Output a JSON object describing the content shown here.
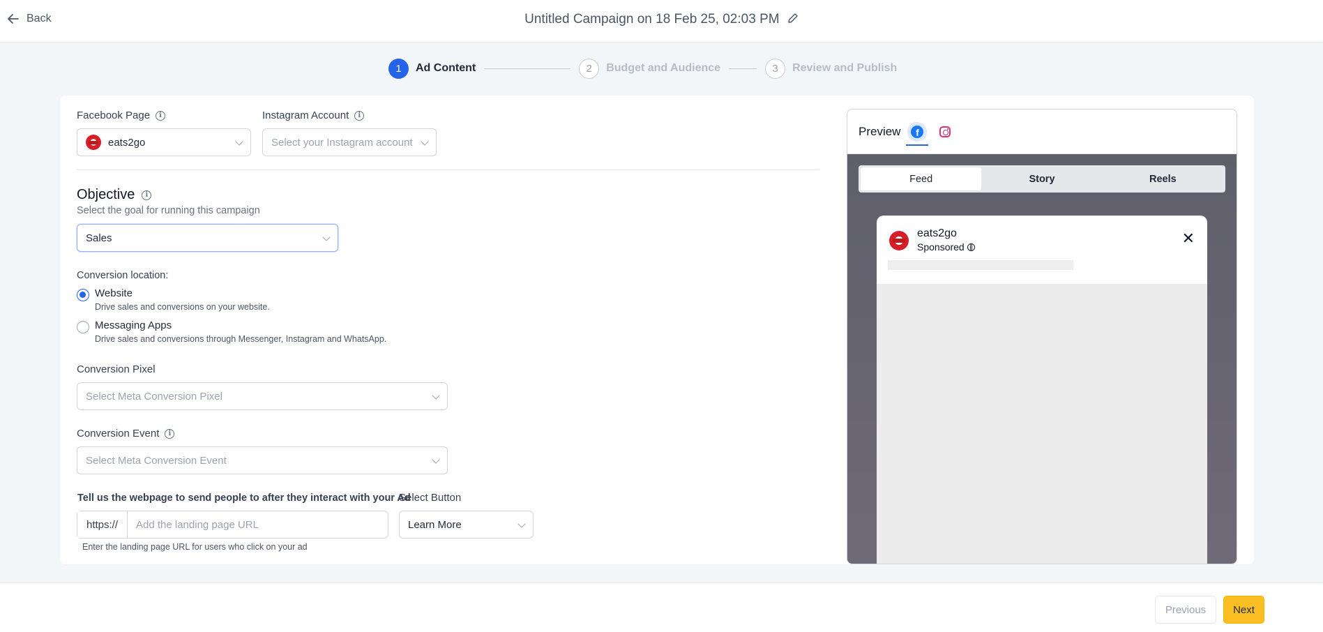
{
  "header": {
    "back_label": "Back",
    "title": "Untitled Campaign on 18 Feb 25, 02:03 PM"
  },
  "stepper": {
    "steps": [
      {
        "number": "1",
        "label": "Ad Content",
        "state": "active"
      },
      {
        "number": "2",
        "label": "Budget and Audience",
        "state": "inactive"
      },
      {
        "number": "3",
        "label": "Review and Publish",
        "state": "inactive"
      }
    ]
  },
  "form": {
    "facebook_page": {
      "label": "Facebook Page",
      "value": "eats2go"
    },
    "instagram_account": {
      "label": "Instagram Account",
      "placeholder": "Select your Instagram account"
    },
    "objective": {
      "title": "Objective",
      "subtitle": "Select the goal for running this campaign",
      "value": "Sales"
    },
    "conversion_location": {
      "label": "Conversion location:",
      "options": [
        {
          "title": "Website",
          "description": "Drive sales and conversions on your website.",
          "checked": true
        },
        {
          "title": "Messaging Apps",
          "description": "Drive sales and conversions through Messenger, Instagram and WhatsApp.",
          "checked": false
        }
      ]
    },
    "conversion_pixel": {
      "label": "Conversion Pixel",
      "placeholder": "Select Meta Conversion Pixel"
    },
    "conversion_event": {
      "label": "Conversion Event",
      "placeholder": "Select Meta Conversion Event"
    },
    "landing_page": {
      "label": "Tell us the webpage to send people to after they interact with your Ad",
      "prefix": "https://",
      "placeholder": "Add the landing page URL",
      "value": "",
      "help": "Enter the landing page URL for users who click on your ad"
    },
    "select_button": {
      "label": "Select Button",
      "value": "Learn More"
    }
  },
  "preview": {
    "title": "Preview",
    "platform_icons": [
      "facebook-icon",
      "instagram-icon"
    ],
    "tabs": [
      "Feed",
      "Story",
      "Reels"
    ],
    "active_tab": "Feed",
    "ad": {
      "page_name": "eats2go",
      "sponsored": "Sponsored"
    }
  },
  "footer": {
    "previous_label": "Previous",
    "next_label": "Next"
  },
  "colors": {
    "primary": "#2563eb",
    "next_button": "#fbbf24"
  }
}
